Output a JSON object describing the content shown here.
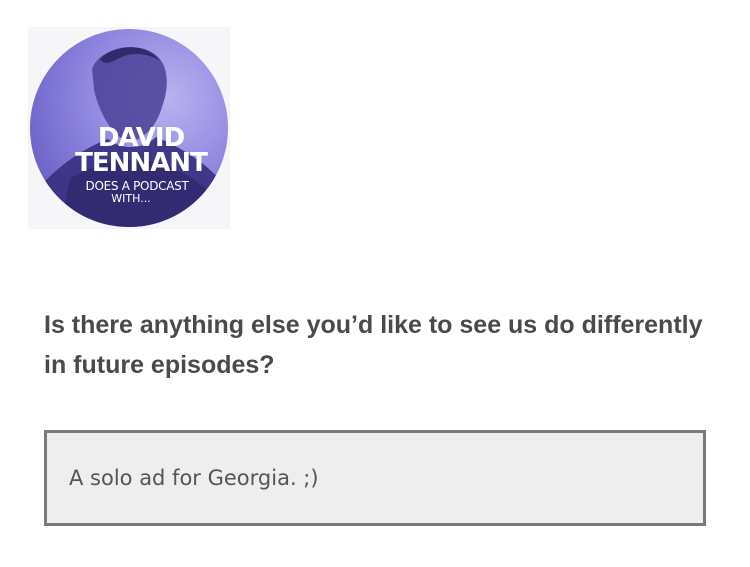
{
  "podcast_logo": {
    "title_line1": "DAVID",
    "title_line2": "TENNANT",
    "subtitle_line1": "DOES A PODCAST",
    "subtitle_line2": "WITH..."
  },
  "survey": {
    "question": "Is there anything else you’d like to see us do differently in future episodes?",
    "answer": "A solo ad for Georgia. ;)"
  },
  "colors": {
    "logo_purple": "#8f86e0",
    "question_text": "#4a4a4a",
    "answer_border": "#7a7a7a",
    "answer_background": "#eeeeee"
  }
}
